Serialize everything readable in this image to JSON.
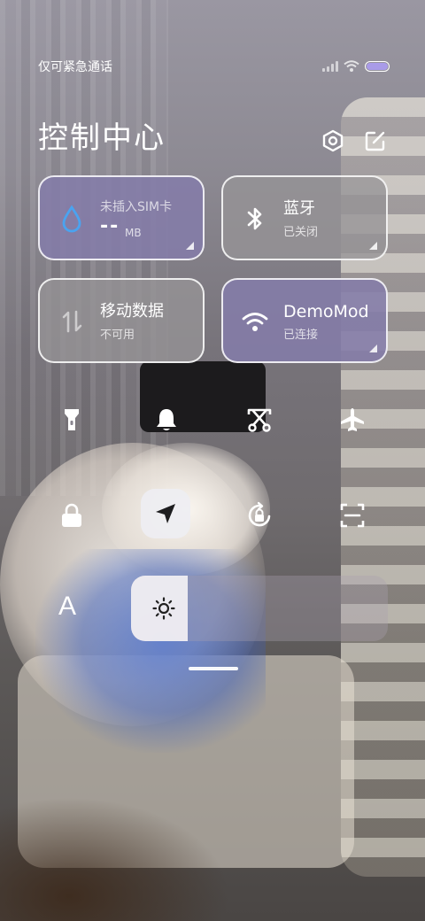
{
  "status_bar": {
    "carrier_text": "仅可紧急通话",
    "signal_icon": "signal-bars-icon",
    "wifi_icon": "wifi-icon",
    "battery_icon": "battery-icon",
    "battery_color": "#a99be8"
  },
  "header": {
    "title": "控制中心",
    "settings_icon": "settings-hex-icon",
    "edit_icon": "edit-icon"
  },
  "tiles": [
    {
      "id": "data-usage",
      "icon": "water-drop-icon",
      "primary": "未插入SIM卡",
      "value": "--",
      "unit": "MB",
      "color": "#847ca8"
    },
    {
      "id": "bluetooth",
      "icon": "bluetooth-icon",
      "primary": "蓝牙",
      "secondary": "已关闭",
      "color": "#969496"
    },
    {
      "id": "mobile-data",
      "icon": "mobile-data-arrows-icon",
      "primary": "移动数据",
      "secondary": "不可用",
      "color": "#969496"
    },
    {
      "id": "wifi",
      "icon": "wifi-icon",
      "primary": "DemoMod",
      "secondary": "已连接",
      "color": "#847ca8"
    }
  ],
  "quick_toggles_row1": [
    {
      "id": "flashlight",
      "icon": "flashlight-icon"
    },
    {
      "id": "ringer",
      "icon": "bell-icon"
    },
    {
      "id": "screenshot",
      "icon": "screenshot-scissors-icon"
    },
    {
      "id": "airplane",
      "icon": "airplane-icon"
    }
  ],
  "quick_toggles_row2": [
    {
      "id": "lock",
      "icon": "lock-icon"
    },
    {
      "id": "location",
      "icon": "location-arrow-icon",
      "active": true
    },
    {
      "id": "rotation-lock",
      "icon": "rotation-lock-icon"
    },
    {
      "id": "scanner",
      "icon": "scan-icon"
    }
  ],
  "font_button": {
    "label": "A",
    "icon": "font-size-icon"
  },
  "brightness": {
    "level": 0.22,
    "icon": "sun-icon"
  }
}
